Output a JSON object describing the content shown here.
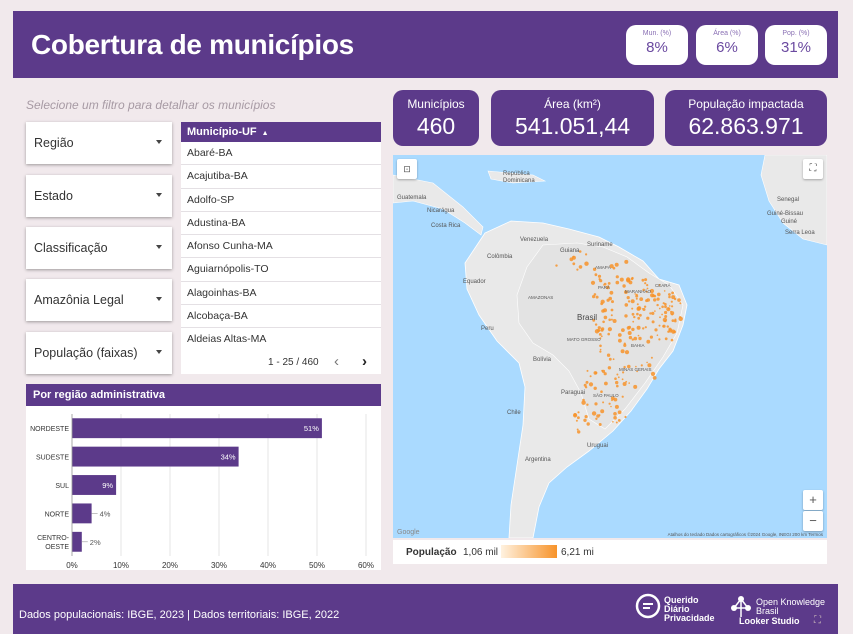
{
  "header": {
    "title": "Cobertura de municípios",
    "pills": [
      {
        "label": "Mun. (%)",
        "value": "8%"
      },
      {
        "label": "Área (%)",
        "value": "6%"
      },
      {
        "label": "Pop. (%)",
        "value": "31%"
      }
    ]
  },
  "filters": {
    "hint": "Selecione um filtro para detalhar os municípios",
    "dropdowns": [
      "Região",
      "Estado",
      "Classificação",
      "Amazônia Legal",
      "População (faixas)"
    ]
  },
  "table": {
    "header": "Município-UF",
    "rows": [
      "Abaré-BA",
      "Acajutiba-BA",
      "Adolfo-SP",
      "Adustina-BA",
      "Afonso Cunha-MA",
      "Aguiarnópolis-TO",
      "Alagoinhas-BA",
      "Alcobaça-BA",
      "Aldeias Altas-MA"
    ],
    "pagination": "1 - 25 / 460"
  },
  "kpis": [
    {
      "label": "Municípios",
      "value": "460"
    },
    {
      "label": "Área (km²)",
      "value": "541.051,44"
    },
    {
      "label": "População impactada",
      "value": "62.863.971"
    }
  ],
  "map": {
    "labels": {
      "guatemala": "Guatemala",
      "nicaragua": "Nicarágua",
      "costa_rica": "Costa Rica",
      "republica": "República",
      "dominicana": "Dominicana",
      "venezuela": "Venezuela",
      "guiana": "Guiana",
      "suriname": "Suriname",
      "colombia": "Colômbia",
      "equador": "Equador",
      "peru": "Peru",
      "brasil": "Brasil",
      "bolivia": "Bolívia",
      "paraguai": "Paraguai",
      "chile": "Chile",
      "argentina": "Argentina",
      "uruguai": "Uruguai",
      "senegal": "Senegal",
      "guine_bissau": "Guiné-Bissau",
      "guine": "Guiné",
      "serra_leoa": "Serra Leoa",
      "amazonas": "AMAZONAS",
      "para": "PARÁ",
      "bahia": "BAHIA",
      "mato_grosso": "MATO GROSSO",
      "minas_gerais": "MINAS GERAIS",
      "sao_paulo": "SÃO PAULO",
      "amapa": "AMAPÁ",
      "maranhao": "MARANHÃO",
      "ceara": "CEARÁ"
    },
    "attribution": "Atalhos do teclado   Dados cartográficos ©2024 Google, INEGI   200 km   Termos",
    "google": "Google",
    "zoom_in": "+",
    "zoom_out": "−"
  },
  "legend": {
    "title": "População",
    "min": "1,06 mil",
    "max": "6,21 mi"
  },
  "region_chart": {
    "title": "Por região administrativa",
    "chart_data": {
      "type": "bar",
      "orientation": "horizontal",
      "categories": [
        "NORDESTE",
        "SUDESTE",
        "SUL",
        "NORTE",
        "CENTRO-OESTE"
      ],
      "values": [
        51,
        34,
        9,
        4,
        2
      ],
      "value_labels": [
        "51%",
        "34%",
        "9%",
        "4%",
        "2%"
      ],
      "xlim": [
        0,
        60
      ],
      "xticks": [
        "0%",
        "10%",
        "20%",
        "30%",
        "40%",
        "50%",
        "60%"
      ],
      "color": "#5c3a8a",
      "grid": true
    }
  },
  "footer": {
    "text": "Dados populacionais: IBGE, 2023   |   Dados territoriais: IBGE, 2022",
    "logo1": [
      "Querido",
      "Diário",
      "Privacidade"
    ],
    "logo2": [
      "Open Knowledge",
      "Brasil"
    ],
    "logo3": "Looker Studio"
  },
  "colors": {
    "brand": "#5c3a8a",
    "map_dots": "#f7932a",
    "background": "#f1e9ec"
  }
}
